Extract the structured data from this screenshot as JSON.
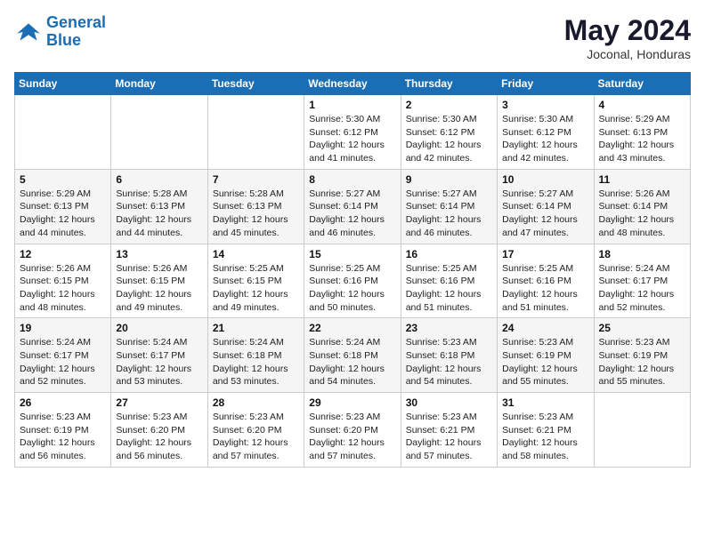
{
  "header": {
    "logo_line1": "General",
    "logo_line2": "Blue",
    "month": "May 2024",
    "location": "Joconal, Honduras"
  },
  "days_of_week": [
    "Sunday",
    "Monday",
    "Tuesday",
    "Wednesday",
    "Thursday",
    "Friday",
    "Saturday"
  ],
  "weeks": [
    [
      {
        "day": "",
        "info": ""
      },
      {
        "day": "",
        "info": ""
      },
      {
        "day": "",
        "info": ""
      },
      {
        "day": "1",
        "info": "Sunrise: 5:30 AM\nSunset: 6:12 PM\nDaylight: 12 hours\nand 41 minutes."
      },
      {
        "day": "2",
        "info": "Sunrise: 5:30 AM\nSunset: 6:12 PM\nDaylight: 12 hours\nand 42 minutes."
      },
      {
        "day": "3",
        "info": "Sunrise: 5:30 AM\nSunset: 6:12 PM\nDaylight: 12 hours\nand 42 minutes."
      },
      {
        "day": "4",
        "info": "Sunrise: 5:29 AM\nSunset: 6:13 PM\nDaylight: 12 hours\nand 43 minutes."
      }
    ],
    [
      {
        "day": "5",
        "info": "Sunrise: 5:29 AM\nSunset: 6:13 PM\nDaylight: 12 hours\nand 44 minutes."
      },
      {
        "day": "6",
        "info": "Sunrise: 5:28 AM\nSunset: 6:13 PM\nDaylight: 12 hours\nand 44 minutes."
      },
      {
        "day": "7",
        "info": "Sunrise: 5:28 AM\nSunset: 6:13 PM\nDaylight: 12 hours\nand 45 minutes."
      },
      {
        "day": "8",
        "info": "Sunrise: 5:27 AM\nSunset: 6:14 PM\nDaylight: 12 hours\nand 46 minutes."
      },
      {
        "day": "9",
        "info": "Sunrise: 5:27 AM\nSunset: 6:14 PM\nDaylight: 12 hours\nand 46 minutes."
      },
      {
        "day": "10",
        "info": "Sunrise: 5:27 AM\nSunset: 6:14 PM\nDaylight: 12 hours\nand 47 minutes."
      },
      {
        "day": "11",
        "info": "Sunrise: 5:26 AM\nSunset: 6:14 PM\nDaylight: 12 hours\nand 48 minutes."
      }
    ],
    [
      {
        "day": "12",
        "info": "Sunrise: 5:26 AM\nSunset: 6:15 PM\nDaylight: 12 hours\nand 48 minutes."
      },
      {
        "day": "13",
        "info": "Sunrise: 5:26 AM\nSunset: 6:15 PM\nDaylight: 12 hours\nand 49 minutes."
      },
      {
        "day": "14",
        "info": "Sunrise: 5:25 AM\nSunset: 6:15 PM\nDaylight: 12 hours\nand 49 minutes."
      },
      {
        "day": "15",
        "info": "Sunrise: 5:25 AM\nSunset: 6:16 PM\nDaylight: 12 hours\nand 50 minutes."
      },
      {
        "day": "16",
        "info": "Sunrise: 5:25 AM\nSunset: 6:16 PM\nDaylight: 12 hours\nand 51 minutes."
      },
      {
        "day": "17",
        "info": "Sunrise: 5:25 AM\nSunset: 6:16 PM\nDaylight: 12 hours\nand 51 minutes."
      },
      {
        "day": "18",
        "info": "Sunrise: 5:24 AM\nSunset: 6:17 PM\nDaylight: 12 hours\nand 52 minutes."
      }
    ],
    [
      {
        "day": "19",
        "info": "Sunrise: 5:24 AM\nSunset: 6:17 PM\nDaylight: 12 hours\nand 52 minutes."
      },
      {
        "day": "20",
        "info": "Sunrise: 5:24 AM\nSunset: 6:17 PM\nDaylight: 12 hours\nand 53 minutes."
      },
      {
        "day": "21",
        "info": "Sunrise: 5:24 AM\nSunset: 6:18 PM\nDaylight: 12 hours\nand 53 minutes."
      },
      {
        "day": "22",
        "info": "Sunrise: 5:24 AM\nSunset: 6:18 PM\nDaylight: 12 hours\nand 54 minutes."
      },
      {
        "day": "23",
        "info": "Sunrise: 5:23 AM\nSunset: 6:18 PM\nDaylight: 12 hours\nand 54 minutes."
      },
      {
        "day": "24",
        "info": "Sunrise: 5:23 AM\nSunset: 6:19 PM\nDaylight: 12 hours\nand 55 minutes."
      },
      {
        "day": "25",
        "info": "Sunrise: 5:23 AM\nSunset: 6:19 PM\nDaylight: 12 hours\nand 55 minutes."
      }
    ],
    [
      {
        "day": "26",
        "info": "Sunrise: 5:23 AM\nSunset: 6:19 PM\nDaylight: 12 hours\nand 56 minutes."
      },
      {
        "day": "27",
        "info": "Sunrise: 5:23 AM\nSunset: 6:20 PM\nDaylight: 12 hours\nand 56 minutes."
      },
      {
        "day": "28",
        "info": "Sunrise: 5:23 AM\nSunset: 6:20 PM\nDaylight: 12 hours\nand 57 minutes."
      },
      {
        "day": "29",
        "info": "Sunrise: 5:23 AM\nSunset: 6:20 PM\nDaylight: 12 hours\nand 57 minutes."
      },
      {
        "day": "30",
        "info": "Sunrise: 5:23 AM\nSunset: 6:21 PM\nDaylight: 12 hours\nand 57 minutes."
      },
      {
        "day": "31",
        "info": "Sunrise: 5:23 AM\nSunset: 6:21 PM\nDaylight: 12 hours\nand 58 minutes."
      },
      {
        "day": "",
        "info": ""
      }
    ]
  ]
}
